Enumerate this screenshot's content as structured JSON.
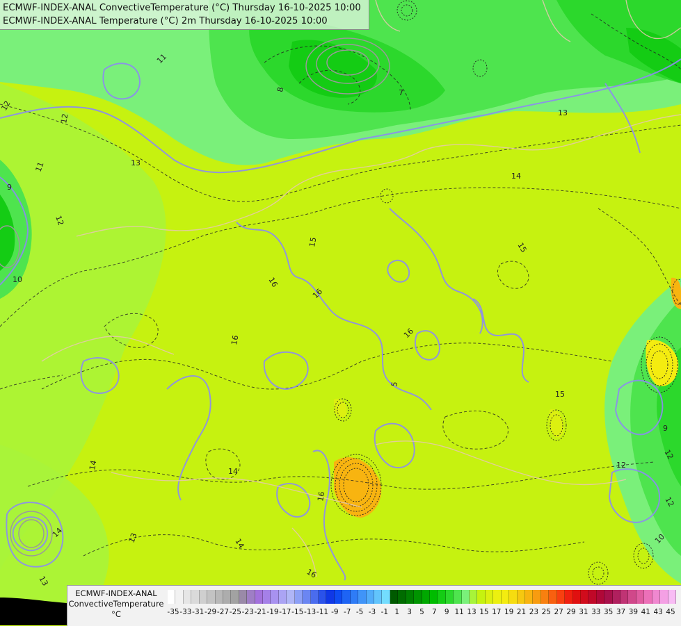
{
  "title": {
    "line1": "ECMWF-INDEX-ANAL ConvectiveTemperature (°C) Thursday 16-10-2025 10:00",
    "line2": "ECMWF-INDEX-ANAL Temperature (°C) 2m Thursday 16-10-2025 10:00"
  },
  "legend": {
    "source": "ECMWF-INDEX-ANAL",
    "variable": "ConvectiveTemperature",
    "unit": "°C",
    "colors": [
      "#ffffff",
      "#f2f2f2",
      "#e6e6e6",
      "#dadada",
      "#cfcfcf",
      "#c3c3c3",
      "#b8b8b8",
      "#adadad",
      "#a2a2a2",
      "#9a8aa8",
      "#9f7ec5",
      "#a371dc",
      "#a580e8",
      "#a892f0",
      "#aba4f4",
      "#b0b6f6",
      "#8da0f6",
      "#6b86f2",
      "#4a6cee",
      "#2a52ea",
      "#1038e6",
      "#0f4cf2",
      "#1e64f4",
      "#2f7cf6",
      "#4094f8",
      "#51acfa",
      "#62c4fc",
      "#73dcfe",
      "#005a00",
      "#006c00",
      "#008000",
      "#009400",
      "#00a800",
      "#00bc00",
      "#14cc14",
      "#2cd82c",
      "#4ee44e",
      "#7af07a",
      "#a8f43a",
      "#c6f210",
      "#dcf010",
      "#ecf010",
      "#f4ec10",
      "#f6dc10",
      "#f6c810",
      "#f8b410",
      "#f89c10",
      "#f88010",
      "#f86010",
      "#f84010",
      "#f02010",
      "#e01010",
      "#d00c1c",
      "#c00828",
      "#b00838",
      "#a8104a",
      "#b0205e",
      "#c03474",
      "#d0488a",
      "#e05ca0",
      "#ec70b8",
      "#f088d0",
      "#f4a0e4",
      "#f8bcf4"
    ],
    "ticks": [
      "-35",
      "-33",
      "-31",
      "-29",
      "-27",
      "-25",
      "-23",
      "-21",
      "-19",
      "-17",
      "-15",
      "-13",
      "-11",
      "-9",
      "-7",
      "-5",
      "-3",
      "-1",
      "1",
      "3",
      "5",
      "7",
      "9",
      "11",
      "13",
      "15",
      "17",
      "19",
      "21",
      "23",
      "25",
      "27",
      "29",
      "31",
      "33",
      "35",
      "37",
      "39",
      "41",
      "43",
      "45"
    ]
  },
  "contour_labels": [
    "13",
    "12",
    "11",
    "9",
    "10",
    "12",
    "12",
    "11",
    "8",
    "7",
    "13",
    "14",
    "15",
    "15",
    "16",
    "16",
    "16",
    "16",
    "15",
    "14",
    "13",
    "14",
    "12",
    "12",
    "10",
    "9",
    "12",
    "16",
    "14",
    "13",
    "16",
    "5",
    "14"
  ]
}
